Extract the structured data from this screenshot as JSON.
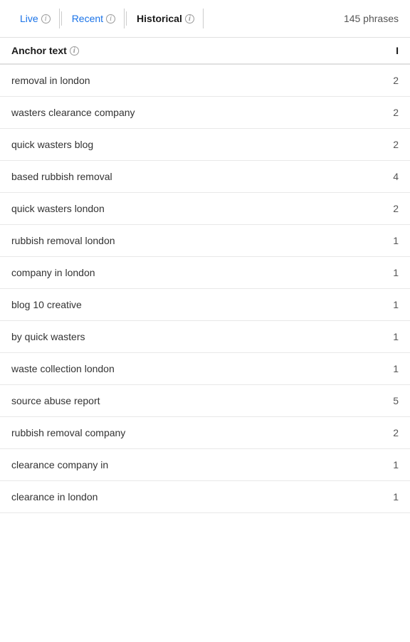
{
  "tabs": [
    {
      "id": "live",
      "label": "Live",
      "active": false
    },
    {
      "id": "recent",
      "label": "Recent",
      "active": false
    },
    {
      "id": "historical",
      "label": "Historical",
      "active": true
    }
  ],
  "phrases_count": "145 phrases",
  "table": {
    "header": {
      "anchor_label": "Anchor text",
      "count_label": "I"
    },
    "rows": [
      {
        "text": "removal in london",
        "value": "2"
      },
      {
        "text": "wasters clearance company",
        "value": "2"
      },
      {
        "text": "quick wasters blog",
        "value": "2"
      },
      {
        "text": "based rubbish removal",
        "value": "4"
      },
      {
        "text": "quick wasters london",
        "value": "2"
      },
      {
        "text": "rubbish removal london",
        "value": "1"
      },
      {
        "text": "company in london",
        "value": "1"
      },
      {
        "text": "blog 10 creative",
        "value": "1"
      },
      {
        "text": "by quick wasters",
        "value": "1"
      },
      {
        "text": "waste collection london",
        "value": "1"
      },
      {
        "text": "source abuse report",
        "value": "5"
      },
      {
        "text": "rubbish removal company",
        "value": "2"
      },
      {
        "text": "clearance company in",
        "value": "1"
      },
      {
        "text": "clearance in london",
        "value": "1"
      }
    ]
  }
}
